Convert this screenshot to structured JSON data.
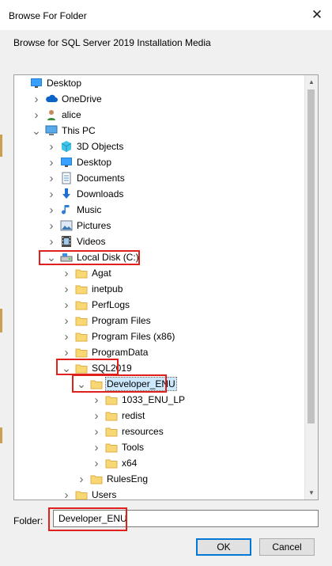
{
  "window": {
    "title": "Browse For Folder",
    "close_glyph": "✕"
  },
  "description": "Browse for SQL Server 2019 Installation Media",
  "tree": [
    {
      "label": "Desktop",
      "icon": "desktop-icon",
      "chevron": ""
    },
    {
      "label": "OneDrive",
      "icon": "cloud-icon",
      "chevron": "right"
    },
    {
      "label": "alice",
      "icon": "user-icon",
      "chevron": "right"
    },
    {
      "label": "This PC",
      "icon": "computer-icon",
      "chevron": "down"
    },
    {
      "label": "3D Objects",
      "icon": "cube-icon",
      "chevron": "right"
    },
    {
      "label": "Desktop",
      "icon": "desktop-icon",
      "chevron": "right"
    },
    {
      "label": "Documents",
      "icon": "document-icon",
      "chevron": "right"
    },
    {
      "label": "Downloads",
      "icon": "download-icon",
      "chevron": "right"
    },
    {
      "label": "Music",
      "icon": "music-icon",
      "chevron": "right"
    },
    {
      "label": "Pictures",
      "icon": "picture-icon",
      "chevron": "right"
    },
    {
      "label": "Videos",
      "icon": "video-icon",
      "chevron": "right"
    },
    {
      "label": "Local Disk (C:)",
      "icon": "drive-icon",
      "chevron": "down"
    },
    {
      "label": "Agat",
      "icon": "folder-icon",
      "chevron": "right"
    },
    {
      "label": "inetpub",
      "icon": "folder-icon",
      "chevron": "right"
    },
    {
      "label": "PerfLogs",
      "icon": "folder-icon",
      "chevron": "right"
    },
    {
      "label": "Program Files",
      "icon": "folder-icon",
      "chevron": "right"
    },
    {
      "label": "Program Files (x86)",
      "icon": "folder-icon",
      "chevron": "right"
    },
    {
      "label": "ProgramData",
      "icon": "folder-icon",
      "chevron": "right"
    },
    {
      "label": "SQL2019",
      "icon": "folder-icon",
      "chevron": "down"
    },
    {
      "label": "Developer_ENU",
      "icon": "folder-icon",
      "chevron": "down",
      "selected": true
    },
    {
      "label": "1033_ENU_LP",
      "icon": "folder-icon",
      "chevron": "right"
    },
    {
      "label": "redist",
      "icon": "folder-icon",
      "chevron": "right"
    },
    {
      "label": "resources",
      "icon": "folder-icon",
      "chevron": "right"
    },
    {
      "label": "Tools",
      "icon": "folder-icon",
      "chevron": "right"
    },
    {
      "label": "x64",
      "icon": "folder-icon",
      "chevron": "right"
    },
    {
      "label": "RulesEng",
      "icon": "folder-icon",
      "chevron": "right"
    },
    {
      "label": "Users",
      "icon": "folder-icon",
      "chevron": "right"
    }
  ],
  "folder_field": {
    "label": "Folder:",
    "value": "Developer_ENU"
  },
  "buttons": {
    "ok": "OK",
    "cancel": "Cancel"
  },
  "colors": {
    "selection": "#cce8ff",
    "highlight": "#e0201d",
    "default_button_border": "#0078d7"
  }
}
